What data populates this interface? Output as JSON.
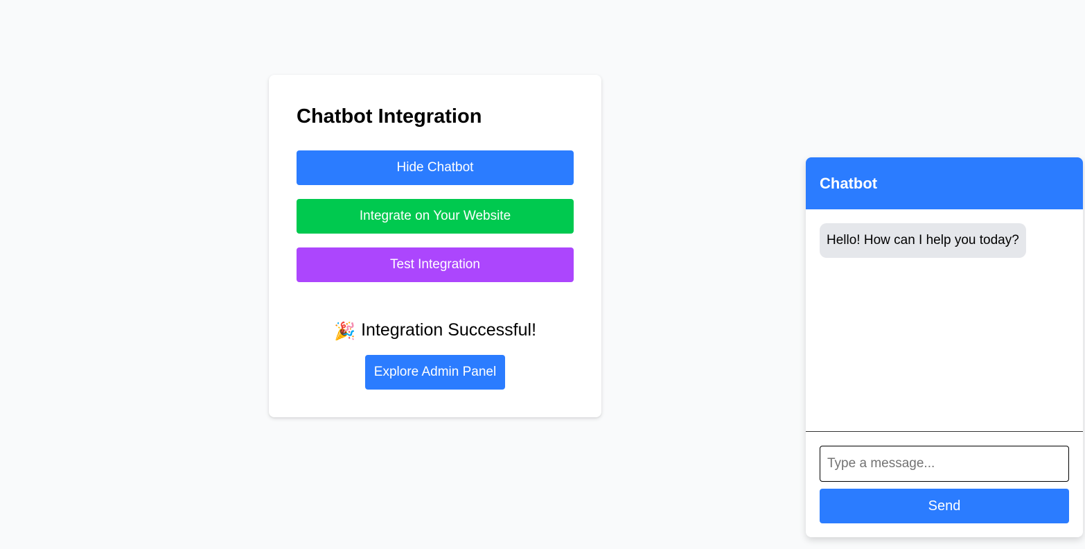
{
  "integration_card": {
    "title": "Chatbot Integration",
    "hide_chatbot_label": "Hide Chatbot",
    "integrate_label": "Integrate on Your Website",
    "test_label": "Test Integration",
    "success_icon": "🎉",
    "success_text": "Integration Successful!",
    "admin_panel_label": "Explore Admin Panel"
  },
  "chatbot": {
    "title": "Chatbot",
    "messages": [
      {
        "from": "bot",
        "text": "Hello! How can I help you today?"
      }
    ],
    "input_placeholder": "Type a message...",
    "send_label": "Send"
  },
  "colors": {
    "primary_blue": "#2b7cff",
    "green": "#00c94f",
    "purple": "#ac46fd",
    "bubble_gray": "#e5e7eb",
    "page_bg": "#f9fafb"
  }
}
